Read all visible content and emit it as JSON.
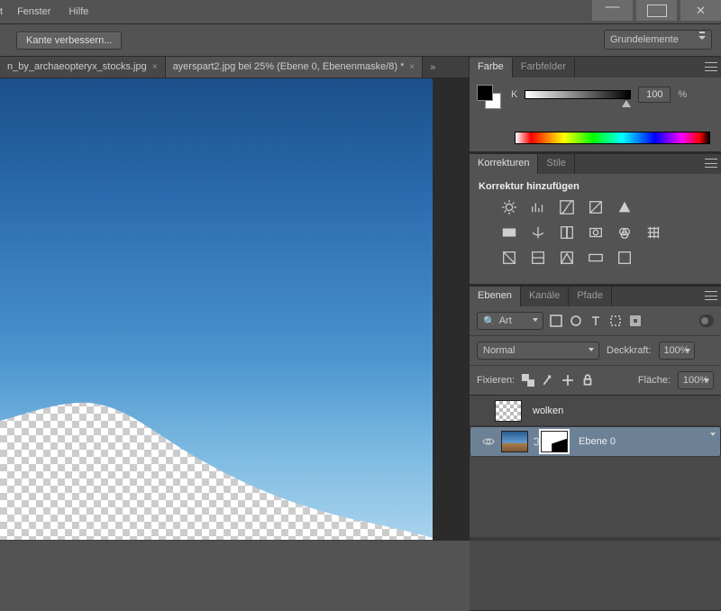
{
  "menu": {
    "t": "t",
    "fenster": "Fenster",
    "hilfe": "Hilfe"
  },
  "optbar": {
    "refine": "Kante verbessern...",
    "workspace": "Grundelemente"
  },
  "tabs": {
    "inactive": "n_by_archaeopteryx_stocks.jpg",
    "active": "ayerspart2.jpg bei 25% (Ebene 0, Ebenenmaske/8) *"
  },
  "panels": {
    "color": {
      "tab1": "Farbe",
      "tab2": "Farbfelder",
      "k_label": "K",
      "k_value": "100",
      "pct": "%"
    },
    "adjust": {
      "tab1": "Korrekturen",
      "tab2": "Stile",
      "title": "Korrektur hinzufügen"
    },
    "layers": {
      "tab1": "Ebenen",
      "tab2": "Kanäle",
      "tab3": "Pfade",
      "kind": "Art",
      "blend": "Normal",
      "opacity_label": "Deckkraft:",
      "opacity_value": "100%",
      "fill_label": "Fläche:",
      "fill_value": "100%",
      "lock_label": "Fixieren:",
      "layer1": "wolken",
      "layer2": "Ebene 0"
    }
  }
}
